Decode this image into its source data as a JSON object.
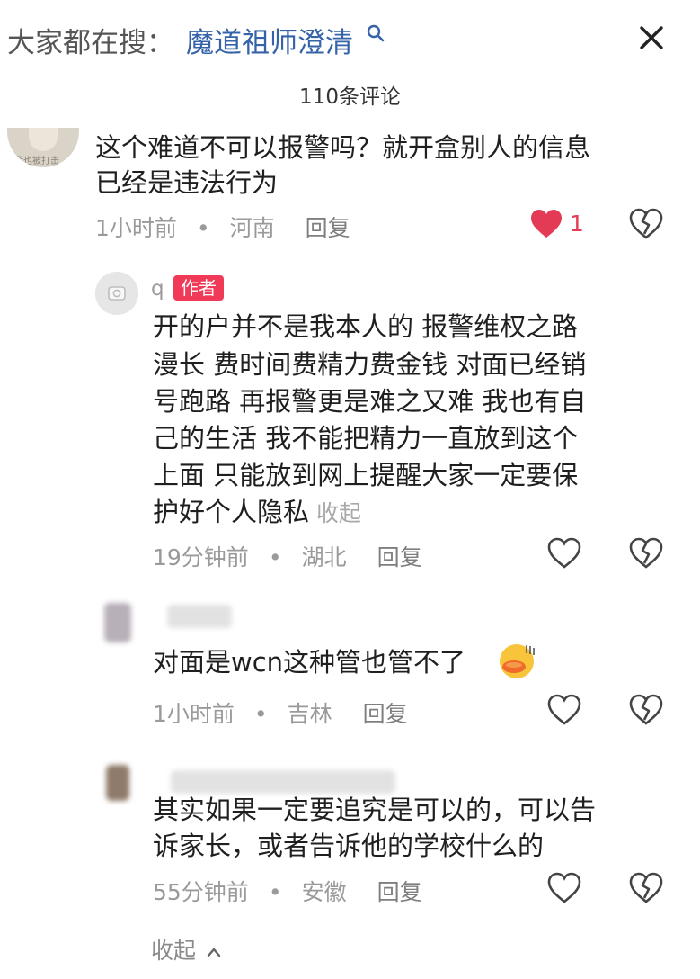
{
  "header": {
    "search_prefix": "大家都在搜：",
    "search_term": "魔道祖师澄清",
    "comment_count": "110条评论"
  },
  "icons": {
    "close": "close-icon",
    "search": "search-icon",
    "like": "heart-icon",
    "dislike": "broken-heart-icon"
  },
  "colors": {
    "accent_blue": "#3563a8",
    "like_red": "#e33a55",
    "author_badge": "#f03a58"
  },
  "comments": [
    {
      "avatar_caption": "我也被打击",
      "lines": [
        "这个难道不可以报警吗？就开盒别人的信息",
        "已经是违法行为"
      ],
      "time": "1小时前",
      "location": "河南",
      "reply": "回复",
      "liked": true,
      "like_count": "1"
    },
    {
      "author_name": "q",
      "author_badge": "作者",
      "lines": [
        "开的户并不是我本人的 报警维权之路",
        "漫长 费时间费精力费金钱 对面已经销",
        "号跑路 再报警更是难之又难 我也有自",
        "己的生活 我不能把精力一直放到这个",
        "上面 只能放到网上提醒大家一定要保",
        "护好个人隐私"
      ],
      "collapse_inline": "收起",
      "time": "19分钟前",
      "location": "湖北",
      "reply": "回复",
      "liked": false
    },
    {
      "lines": [
        "对面是wcn这种管也管不了"
      ],
      "time": "1小时前",
      "location": "吉林",
      "reply": "回复",
      "liked": false
    },
    {
      "lines": [
        "其实如果一定要追究是可以的，可以告",
        "诉家长，或者告诉他的学校什么的"
      ],
      "time": "55分钟前",
      "location": "安徽",
      "reply": "回复",
      "liked": false
    }
  ],
  "footer": {
    "collapse": "收起"
  }
}
